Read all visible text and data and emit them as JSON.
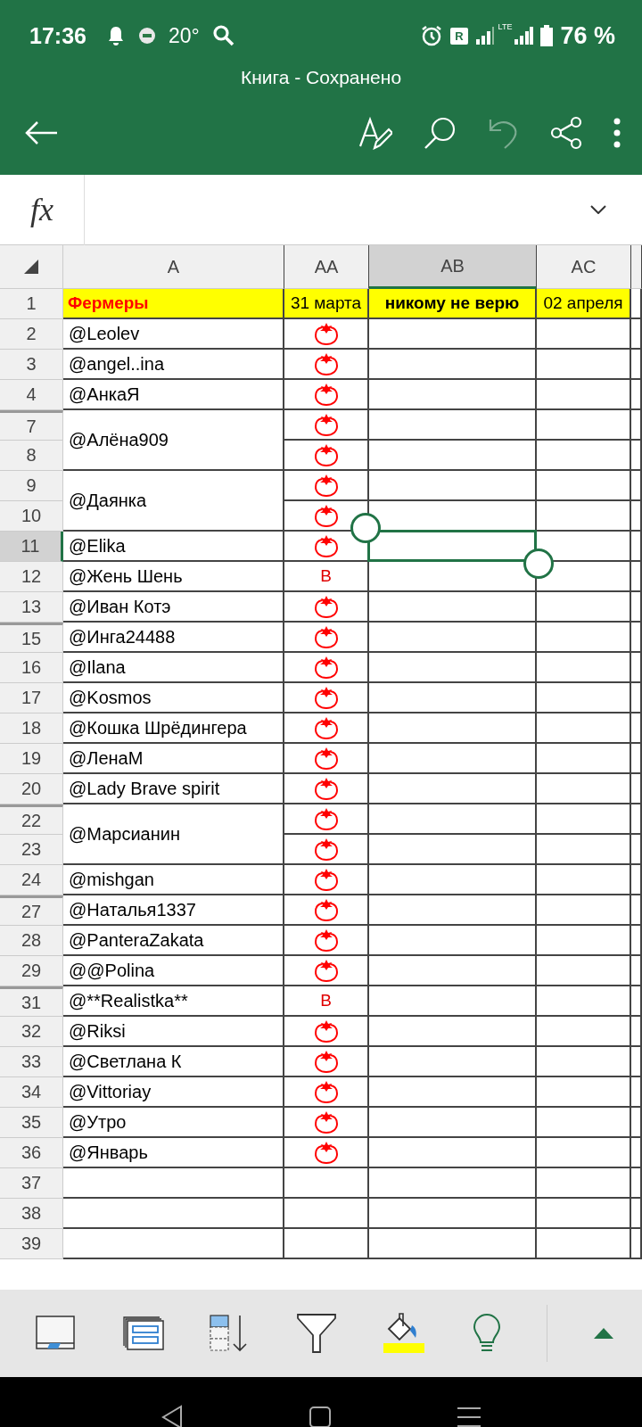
{
  "status_bar": {
    "time": "17:36",
    "temperature": "20°",
    "roaming": "R",
    "network": "LTE",
    "battery": "76 %"
  },
  "window": {
    "title": "Книга - Сохранено"
  },
  "toolbar": [
    {
      "kind": "back",
      "disabled": false
    },
    {
      "kind": "draw",
      "disabled": false
    },
    {
      "kind": "search",
      "disabled": false
    },
    {
      "kind": "undo",
      "disabled": true
    },
    {
      "kind": "share",
      "disabled": false
    },
    {
      "kind": "more",
      "disabled": false
    }
  ],
  "formula_bar": {
    "label": "fx"
  },
  "columns": [
    {
      "label": "A",
      "selected": false
    },
    {
      "label": "AA",
      "selected": false
    },
    {
      "label": "AB",
      "selected": true
    },
    {
      "label": "AC",
      "selected": false
    }
  ],
  "header_row": {
    "number": "1",
    "cells": [
      {
        "text": "Фермеры",
        "bold": true,
        "accent": true
      },
      {
        "text": "31 марта",
        "bold": false,
        "accent": false
      },
      {
        "text": "никому не верю",
        "bold": true,
        "accent": false
      },
      {
        "text": "02 апреля",
        "bold": false,
        "accent": false
      }
    ]
  },
  "entries": [
    {
      "name": "@Leolev",
      "rows": [
        {
          "number": "2",
          "gap_above": false,
          "selected": false,
          "mark": {
            "kind": "tomato"
          }
        }
      ]
    },
    {
      "name": "@angel..ina",
      "rows": [
        {
          "number": "3",
          "gap_above": false,
          "selected": false,
          "mark": {
            "kind": "tomato"
          }
        }
      ]
    },
    {
      "name": "@АнкаЯ",
      "rows": [
        {
          "number": "4",
          "gap_above": false,
          "selected": false,
          "mark": {
            "kind": "tomato"
          }
        }
      ]
    },
    {
      "name": "@Алёна909",
      "rows": [
        {
          "number": "7",
          "gap_above": true,
          "selected": false,
          "mark": {
            "kind": "tomato"
          }
        },
        {
          "number": "8",
          "gap_above": false,
          "selected": false,
          "mark": {
            "kind": "tomato"
          }
        }
      ]
    },
    {
      "name": "@Даянка",
      "rows": [
        {
          "number": "9",
          "gap_above": false,
          "selected": false,
          "mark": {
            "kind": "tomato"
          }
        },
        {
          "number": "10",
          "gap_above": false,
          "selected": false,
          "mark": {
            "kind": "tomato"
          }
        }
      ]
    },
    {
      "name": "@Elika",
      "rows": [
        {
          "number": "11",
          "gap_above": false,
          "selected": true,
          "mark": {
            "kind": "tomato"
          }
        }
      ]
    },
    {
      "name": "@Жень Шень",
      "rows": [
        {
          "number": "12",
          "gap_above": false,
          "selected": false,
          "mark": {
            "kind": "text",
            "text": "В"
          }
        }
      ]
    },
    {
      "name": "@Иван Котэ",
      "rows": [
        {
          "number": "13",
          "gap_above": false,
          "selected": false,
          "mark": {
            "kind": "tomato"
          }
        }
      ]
    },
    {
      "name": "@Инга24488",
      "rows": [
        {
          "number": "15",
          "gap_above": true,
          "selected": false,
          "mark": {
            "kind": "tomato"
          }
        }
      ]
    },
    {
      "name": "@Ilana",
      "rows": [
        {
          "number": "16",
          "gap_above": false,
          "selected": false,
          "mark": {
            "kind": "tomato"
          }
        }
      ]
    },
    {
      "name": "@Kosmos",
      "rows": [
        {
          "number": "17",
          "gap_above": false,
          "selected": false,
          "mark": {
            "kind": "tomato"
          }
        }
      ]
    },
    {
      "name": "@Кошка Шрёдингера",
      "rows": [
        {
          "number": "18",
          "gap_above": false,
          "selected": false,
          "mark": {
            "kind": "tomato"
          }
        }
      ]
    },
    {
      "name": "@ЛенаМ",
      "rows": [
        {
          "number": "19",
          "gap_above": false,
          "selected": false,
          "mark": {
            "kind": "tomato"
          }
        }
      ]
    },
    {
      "name": "@Lady Brave spirit",
      "rows": [
        {
          "number": "20",
          "gap_above": false,
          "selected": false,
          "mark": {
            "kind": "tomato"
          }
        }
      ]
    },
    {
      "name": "@Марсианин",
      "rows": [
        {
          "number": "22",
          "gap_above": true,
          "selected": false,
          "mark": {
            "kind": "tomato"
          }
        },
        {
          "number": "23",
          "gap_above": false,
          "selected": false,
          "mark": {
            "kind": "tomato"
          }
        }
      ]
    },
    {
      "name": "@mishgan",
      "rows": [
        {
          "number": "24",
          "gap_above": false,
          "selected": false,
          "mark": {
            "kind": "tomato"
          }
        }
      ]
    },
    {
      "name": "@Наталья1337",
      "rows": [
        {
          "number": "27",
          "gap_above": true,
          "selected": false,
          "mark": {
            "kind": "tomato"
          }
        }
      ]
    },
    {
      "name": "@PanteraZakata",
      "rows": [
        {
          "number": "28",
          "gap_above": false,
          "selected": false,
          "mark": {
            "kind": "tomato"
          }
        }
      ]
    },
    {
      "name": "@@Polina",
      "rows": [
        {
          "number": "29",
          "gap_above": false,
          "selected": false,
          "mark": {
            "kind": "tomato"
          }
        }
      ]
    },
    {
      "name": "@**Realistka**",
      "rows": [
        {
          "number": "31",
          "gap_above": true,
          "selected": false,
          "mark": {
            "kind": "text",
            "text": "В"
          }
        }
      ]
    },
    {
      "name": "@Riksi",
      "rows": [
        {
          "number": "32",
          "gap_above": false,
          "selected": false,
          "mark": {
            "kind": "tomato"
          }
        }
      ]
    },
    {
      "name": "@Светлана К",
      "rows": [
        {
          "number": "33",
          "gap_above": false,
          "selected": false,
          "mark": {
            "kind": "tomato"
          }
        }
      ]
    },
    {
      "name": "@Vittoriay",
      "rows": [
        {
          "number": "34",
          "gap_above": false,
          "selected": false,
          "mark": {
            "kind": "tomato"
          }
        }
      ]
    },
    {
      "name": "@Утро",
      "rows": [
        {
          "number": "35",
          "gap_above": false,
          "selected": false,
          "mark": {
            "kind": "tomato"
          }
        }
      ]
    },
    {
      "name": "@Январь",
      "rows": [
        {
          "number": "36",
          "gap_above": false,
          "selected": false,
          "mark": {
            "kind": "tomato"
          }
        }
      ]
    },
    {
      "rows": [
        {
          "number": "37",
          "gap_above": false,
          "selected": false
        }
      ]
    },
    {
      "rows": [
        {
          "number": "38",
          "gap_above": false,
          "selected": false
        }
      ]
    },
    {
      "rows": [
        {
          "number": "39",
          "gap_above": false,
          "selected": false
        }
      ]
    }
  ]
}
